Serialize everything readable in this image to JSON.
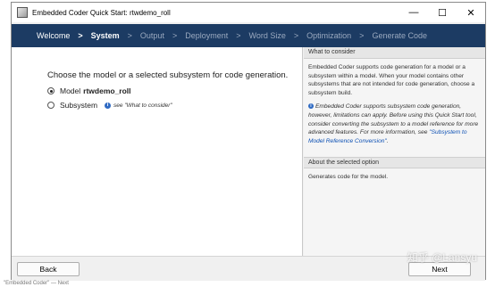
{
  "window": {
    "title": "Embedded Coder Quick Start: rtwdemo_roll",
    "controls": {
      "minimize": "—",
      "maximize": "☐",
      "close": "✕"
    }
  },
  "nav": {
    "steps": [
      "Welcome",
      "System",
      "Output",
      "Deployment",
      "Word Size",
      "Optimization",
      "Generate Code"
    ],
    "separator": ">",
    "current": "System"
  },
  "main": {
    "question": "Choose the model or a selected subsystem for code generation.",
    "option_model_label": "Model",
    "option_model_name": "rtwdemo_roll",
    "option_model_selected": true,
    "option_subsystem_label": "Subsystem",
    "option_subsystem_hint": "see \"What to consider\""
  },
  "side": {
    "consider_header": "What to consider",
    "consider_text": "Embedded Coder supports code generation for a model or a subsystem within a model. When your model contains other subsystems that are not intended for code generation, choose a subsystem build.",
    "note_text": "Embedded Coder supports subsystem code generation, however, limitations can apply. Before using this Quick Start tool, consider converting the subsystem to a model reference for more advanced features. For more information, see",
    "note_link": "\"Subsystem to Model Reference Conversion\"",
    "note_end": ".",
    "about_header": "About the selected option",
    "about_text": "Generates code for the model."
  },
  "footer": {
    "back_label": "Back",
    "next_label": "Next"
  },
  "watermark": "知乎 @Lansyu",
  "bottom_caption": "\"Embedded Coder\" — Next"
}
